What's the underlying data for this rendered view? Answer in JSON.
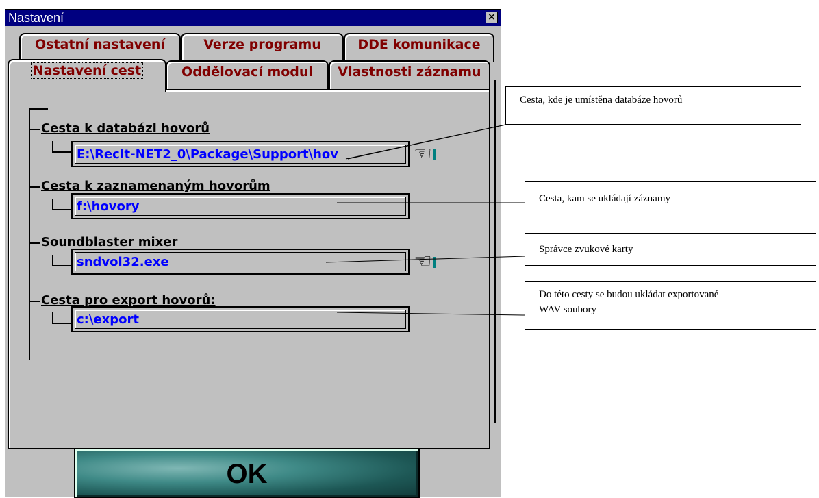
{
  "window": {
    "title": "Nastavení",
    "close_glyph": "×"
  },
  "tabs": {
    "row1": [
      "Ostatní nastavení",
      "Verze programu",
      "DDE komunikace"
    ],
    "row2": [
      "Nastavení cest",
      "Oddělovací modul",
      "Vlastnosti záznamu"
    ],
    "active": "Nastavení cest"
  },
  "paths": [
    {
      "label": "Cesta k databázi hovorů",
      "value": "E:\\RecIt-NET2_0\\Package\\Support\\hov",
      "has_pointer": true
    },
    {
      "label": "Cesta k zaznamenaným hovorům",
      "value": "f:\\hovory",
      "has_pointer": false
    },
    {
      "label": "Soundblaster mixer",
      "value": "sndvol32.exe",
      "has_pointer": true
    },
    {
      "label": "Cesta pro export hovorů:",
      "value": "c:\\export",
      "has_pointer": false
    }
  ],
  "ok_button": {
    "label": "OK"
  },
  "callouts": [
    "Cesta, kde je umístěna databáze hovorů",
    "Cesta, kam se ukládají záznamy",
    "Správce zvukové karty",
    "Do této cesty se budou ukládat exportované WAV soubory"
  ],
  "colors": {
    "title_bar": "#000080",
    "tab_text": "#800000",
    "path_text": "#0000ff",
    "dialog_face": "#c0c0c0"
  },
  "icons": {
    "pointer": "pointing-hand-icon",
    "close": "close-icon"
  }
}
